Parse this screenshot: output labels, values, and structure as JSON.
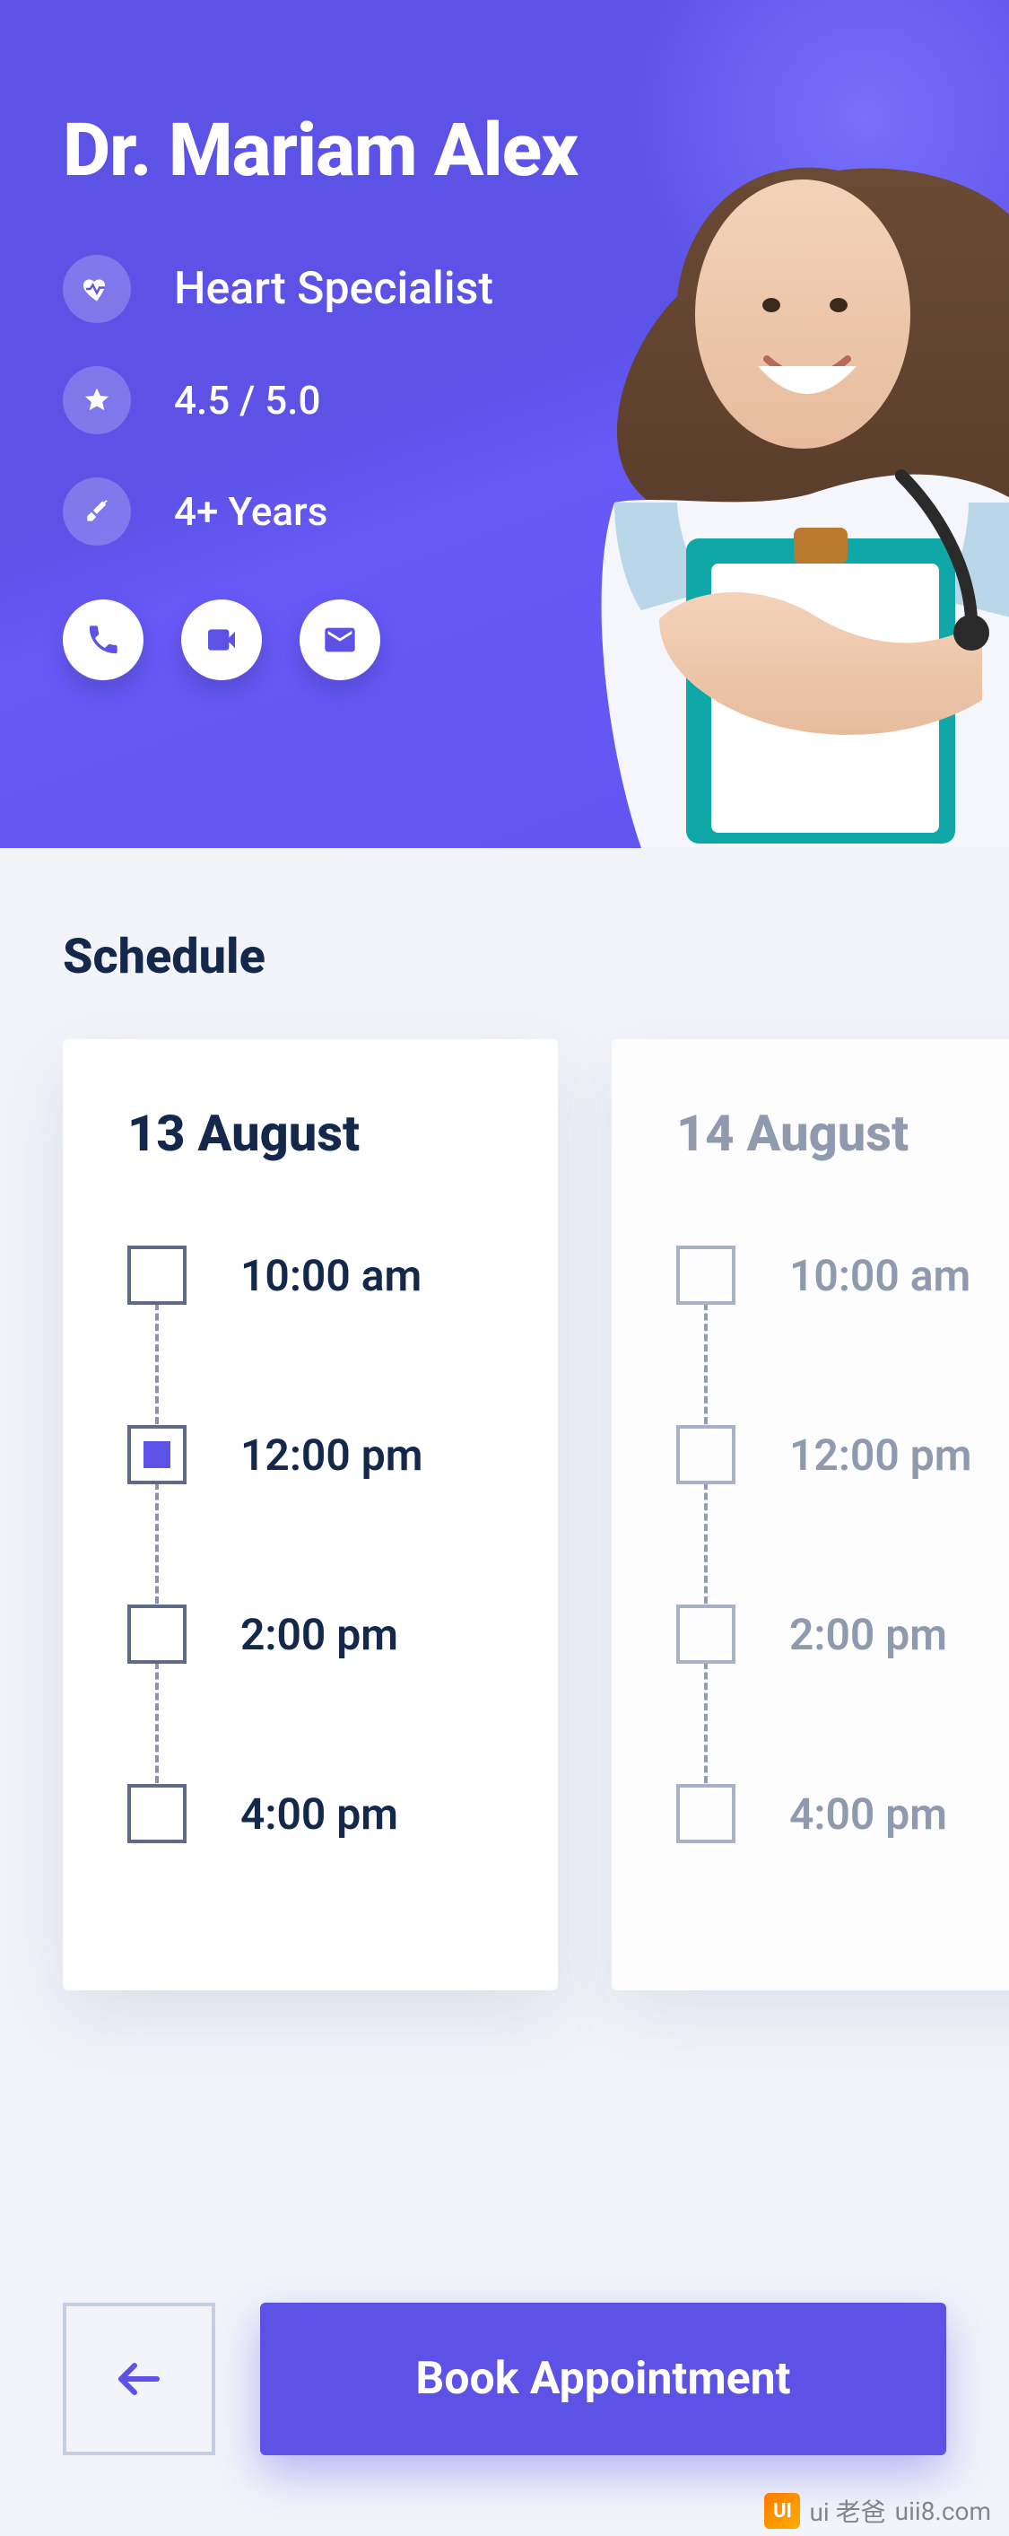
{
  "doctor": {
    "name": "Dr. Mariam Alex",
    "specialty": "Heart Specialist",
    "rating": "4.5 / 5.0",
    "experience": "4+ Years"
  },
  "icons": {
    "heart": "heart-icon",
    "star": "star-icon",
    "syringe": "syringe-icon",
    "phone": "phone-icon",
    "video": "video-icon",
    "mail": "mail-icon",
    "back": "arrow-left-icon"
  },
  "schedule": {
    "title": "Schedule",
    "days": [
      {
        "label": "13 August",
        "active": true,
        "slots": [
          {
            "time": "10:00 am",
            "selected": false
          },
          {
            "time": "12:00 pm",
            "selected": true
          },
          {
            "time": "2:00 pm",
            "selected": false
          },
          {
            "time": "4:00 pm",
            "selected": false
          }
        ]
      },
      {
        "label": "14 August",
        "active": false,
        "slots": [
          {
            "time": "10:00 am",
            "selected": false
          },
          {
            "time": "12:00 pm",
            "selected": false
          },
          {
            "time": "2:00 pm",
            "selected": false
          },
          {
            "time": "4:00 pm",
            "selected": false
          }
        ]
      }
    ]
  },
  "footer": {
    "book_label": "Book Appointment"
  },
  "watermark": {
    "logo": "UI",
    "text1": "ui 老爸",
    "text2": "uii8.com"
  },
  "colors": {
    "primary": "#5C52E6",
    "text_dark": "#13284B",
    "text_muted": "#8591A6"
  }
}
